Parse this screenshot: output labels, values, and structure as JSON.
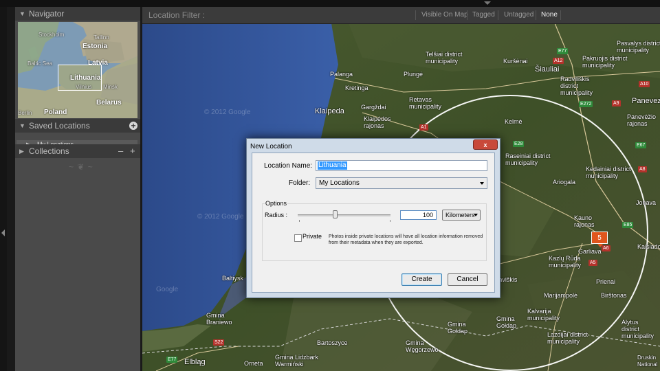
{
  "navigator": {
    "title": "Navigator",
    "labels": {
      "stockholm": "Stockholm",
      "tallinn": "Tallinn",
      "estonia": "Estonia",
      "latvia": "Latvia",
      "baltic_sea": "Baltic Sea",
      "lithuania": "Lithuania",
      "vilnius": "Vilnius",
      "minsk": "Minsk",
      "belarus": "Belarus",
      "poland": "Poland",
      "berlin": "Berlin"
    }
  },
  "saved_locations": {
    "title": "Saved Locations",
    "add_icon": "plus-circle-icon",
    "items": [
      {
        "label": "My Locations"
      }
    ]
  },
  "collections": {
    "title": "Collections",
    "minus": "–",
    "plus": "+"
  },
  "ornament": "~ ❦ ~",
  "filter_bar": {
    "title": "Location Filter :",
    "options": [
      "Visible On Map",
      "Tagged",
      "Untagged",
      "None"
    ],
    "active": "None"
  },
  "map": {
    "watermark": "© 2012 Google",
    "watermark2": "© 2012 Google",
    "watermark3": "Google",
    "places": {
      "telsiai": "Telšiai district\nmunicipality",
      "palanga": "Palanga",
      "plunge": "Plungė",
      "kursenai": "Kuršėnai",
      "siauliai": "Šiauliai",
      "pakruojis": "Pakruojis district\nmunicipality",
      "pasvalys": "Pasvalys district\nmunicipality",
      "kretinga": "Kretinga",
      "radviliskis": "Radviliškis\ndistrict\nmunicipality",
      "panevezys": "Panevezys",
      "klaipeda": "Klaipeda",
      "gargzdai": "Gargždai",
      "retavas": "Retavas\nmunicipality",
      "klaipedos": "Klaipėdos\nrajonas",
      "kelme": "Kelmė",
      "panevezio": "Panevėžio\nrajonas",
      "raseiniai": "Raseiniai district\nmunicipality",
      "kedainiai": "Kedainiai district\nmunicipality",
      "ariogala": "Ariogala",
      "jonava": "Jonava",
      "kauno": "Kauno\nrajonas",
      "kaisiadorys": "Kaisiador",
      "garliava": "Garliava",
      "kazlu": "Kazlų Rūda\nmunicipality",
      "prienai": "Prienai",
      "birstonas": "Birštonas",
      "marijampole": "Marijampolė",
      "vilkaviskis": "Vilkaviškis",
      "kalvarija": "Kalvarija\nmunicipality",
      "lazdijai": "Lazdijai district\nmunicipality",
      "alytus": "Alytus\ndistrict\nmunicipality",
      "baltiysk": "Baltiysk",
      "gmina_braniewo": "Gmina\nBraniewo",
      "gmina_goldap1": "Gmina\nGołdap",
      "gmina_goldap2": "Gmina\nGołdap",
      "bartoszyce": "Bartoszyce",
      "gmina_wegorzewo": "Gmina\nWęgorzewo",
      "elblag": "Elbląg",
      "orneta": "Orneta",
      "gmina_lidzbark": "Gmina Lidzbark\nWarmiński",
      "druskininkai": "Druskin\nNational"
    },
    "roads": [
      "E77",
      "A12",
      "A9",
      "A10",
      "A1",
      "E272",
      "A8",
      "E67",
      "A6",
      "A5",
      "E85",
      "S22",
      "E77",
      "E28"
    ],
    "pin": {
      "count": "5"
    }
  },
  "dialog": {
    "title": "New Location",
    "close": "x",
    "location_name_label": "Location Name:",
    "location_name_value": "Lithuania",
    "folder_label": "Folder:",
    "folder_value": "My Locations",
    "options_label": "Options",
    "radius_label": "Radius :",
    "radius_value": "100",
    "radius_fraction": 0.4,
    "unit_value": "Kilometers",
    "private_label": "Private",
    "private_checked": false,
    "private_note": "Photos inside private locations will have all location information removed from their metadata when they are exported.",
    "create_label": "Create",
    "cancel_label": "Cancel"
  }
}
